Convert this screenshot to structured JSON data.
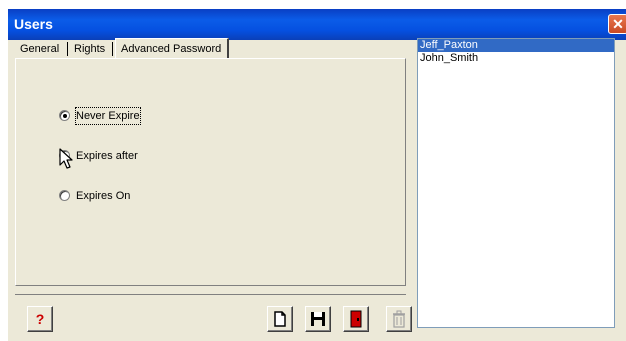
{
  "window": {
    "title": "Users",
    "close_glyph": "✕"
  },
  "tabs": [
    {
      "label": "General",
      "active": false
    },
    {
      "label": "Rights",
      "active": false
    },
    {
      "label": "Advanced Password",
      "active": true
    }
  ],
  "password_options": [
    {
      "label": "Never Expire",
      "checked": true
    },
    {
      "label": "Expires after",
      "checked": false
    },
    {
      "label": "Expires On",
      "checked": false
    }
  ],
  "users_list": [
    {
      "name": "Jeff_Paxton",
      "selected": true
    },
    {
      "name": "John_Smith",
      "selected": false
    }
  ],
  "toolbar": {
    "help_glyph": "?",
    "help_icon": "help-icon",
    "new_icon": "new-document-icon",
    "save_icon": "floppy-disk-icon",
    "exit_icon": "exit-door-icon",
    "delete_icon": "trash-can-icon"
  },
  "colors": {
    "title_bar": "#0b5ce8",
    "selection": "#316ac5",
    "help_glyph": "#cc0000",
    "exit_door": "#cc0000"
  }
}
